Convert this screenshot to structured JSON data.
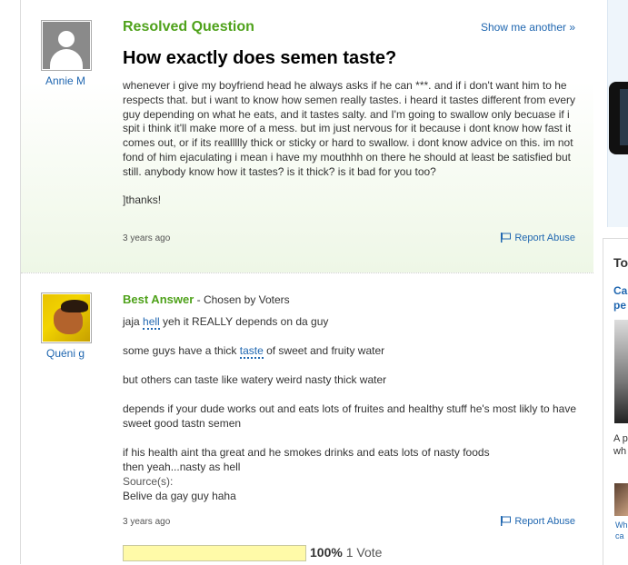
{
  "question": {
    "status_label": "Resolved Question",
    "show_another": "Show me another »",
    "title": "How exactly does semen taste?",
    "asker": "Annie M",
    "body": "whenever i give my boyfriend head he always asks if he can ***. and if i don't want him to he respects that. but i want to know how semen really tastes. i heard it tastes different from every guy depending on what he eats, and it tastes salty. and I'm going to swallow only becuase if i spit i think it'll make more of a mess. but im just nervous for it because i dont know how fast it comes out, or if its reallllly thick or sticky or hard to swallow. i dont know advice on this. im not fond of him ejaculating i mean i have my mouthhh on there he should at least be satisfied but still. anybody know how it tastes? is it thick? is it bad for you too?",
    "body_end": "]thanks!",
    "timestamp": "3 years ago",
    "report_label": "Report Abuse"
  },
  "answer": {
    "label": "Best Answer",
    "chosen_by": " - Chosen by Voters",
    "answerer": "Quéni g",
    "line1_pre": "jaja ",
    "line1_link": "hell",
    "line1_post": " yeh it REALLY depends on da guy",
    "line2_pre": "some guys have a thick ",
    "line2_link": "taste",
    "line2_post": " of sweet and fruity water",
    "line3": "but others can taste like watery weird nasty thick water",
    "line4": "depends if your dude works out and eats lots of fruites and healthy stuff he's most likly to have sweet good tastn semen",
    "line5": "if his health aint tha great and he smokes drinks and eats lots of nasty foods",
    "line6": "then yeah...nasty as hell",
    "source_label": "Source(s):",
    "source_text": "Belive da gay guy haha",
    "timestamp": "3 years ago",
    "report_label": "Report Abuse",
    "vote_percent": "100%",
    "vote_fraction": 1.0,
    "vote_count": " 1 Vote"
  },
  "sidebar": {
    "heading": "To",
    "link1_a": "Ca",
    "link1_b": "pe",
    "text1_a": "A p",
    "text1_b": "wh",
    "small_a": "Wh",
    "small_b": "ca"
  },
  "colors": {
    "accent_green": "#4fa21b",
    "link_blue": "#2067b0",
    "vote_fill": "#fffaa8"
  }
}
